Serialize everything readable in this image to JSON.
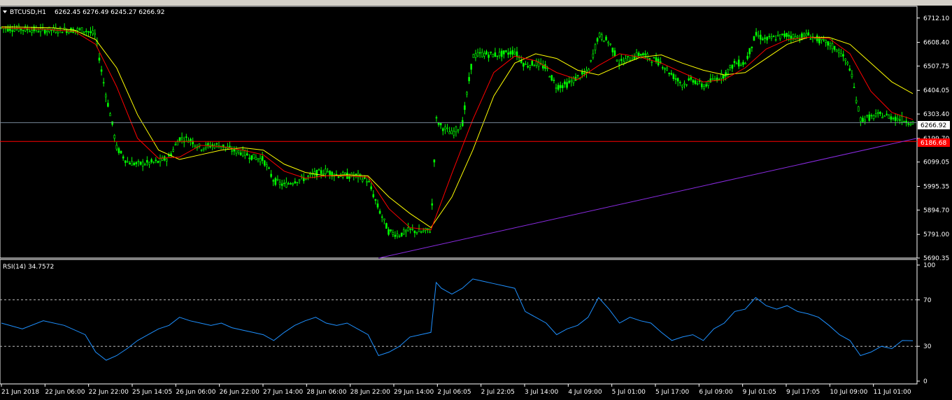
{
  "toolbar": {},
  "price_panel": {
    "title": "BTCUSD,H1",
    "ohlc": "6262.45 6276.49 6245.27 6266.92",
    "current_price_label": "6266.92",
    "red_line_label": "6186.68"
  },
  "rsi_panel": {
    "title": "RSI(14) 34.7572"
  },
  "colors": {
    "background": "#000000",
    "candle": "#00ff00",
    "ma_fast": "#ff0000",
    "ma_slow": "#ffff00",
    "trendline": "#8a2be2",
    "rsi_line": "#1e90ff",
    "horizontal_level": "#ff0000",
    "current_price_line": "#778899",
    "grid_text": "#ffffff"
  },
  "chart_data": [
    {
      "type": "candlestick",
      "symbol": "BTCUSD",
      "timeframe": "H1",
      "ylim": [
        5690.35,
        6762
      ],
      "yticks": [
        6712.1,
        6608.4,
        6507.75,
        6404.05,
        6303.4,
        6199.7,
        6099.05,
        5995.35,
        5894.7,
        5791.0,
        5690.35
      ],
      "ytick_labels": [
        "6712.10",
        "6608.40",
        "6507.75",
        "6404.05",
        "6303.40",
        "6199.70",
        "6099.05",
        "5995.35",
        "5894.70",
        "5791.00",
        "5690.35"
      ],
      "xtick_labels": [
        "21 Jun 2018",
        "22 Jun 06:00",
        "22 Jun 22:00",
        "25 Jun 14:05",
        "26 Jun 06:00",
        "26 Jun 22:00",
        "27 Jun 14:00",
        "28 Jun 06:00",
        "28 Jun 22:00",
        "29 Jun 14:00",
        "2 Jul 06:05",
        "2 Jul 22:05",
        "3 Jul 14:00",
        "4 Jul 09:00",
        "5 Jul 01:00",
        "5 Jul 17:00",
        "6 Jul 09:00",
        "9 Jul 01:05",
        "9 Jul 17:05",
        "10 Jul 09:00",
        "11 Jul 01:00"
      ],
      "price_path": [
        [
          0,
          6670
        ],
        [
          4,
          6665
        ],
        [
          8,
          6660
        ],
        [
          12,
          6662
        ],
        [
          16,
          6660
        ],
        [
          18,
          6640
        ],
        [
          19,
          6500
        ],
        [
          20,
          6380
        ],
        [
          21,
          6280
        ],
        [
          22,
          6160
        ],
        [
          24,
          6100
        ],
        [
          26,
          6090
        ],
        [
          28,
          6095
        ],
        [
          30,
          6100
        ],
        [
          32,
          6120
        ],
        [
          34,
          6200
        ],
        [
          36,
          6195
        ],
        [
          38,
          6160
        ],
        [
          40,
          6170
        ],
        [
          42,
          6170
        ],
        [
          44,
          6150
        ],
        [
          46,
          6140
        ],
        [
          48,
          6120
        ],
        [
          50,
          6110
        ],
        [
          52,
          6020
        ],
        [
          54,
          6000
        ],
        [
          56,
          6020
        ],
        [
          58,
          6030
        ],
        [
          60,
          6050
        ],
        [
          62,
          6060
        ],
        [
          64,
          6045
        ],
        [
          66,
          6040
        ],
        [
          68,
          6040
        ],
        [
          70,
          6020
        ],
        [
          72,
          5900
        ],
        [
          74,
          5800
        ],
        [
          76,
          5790
        ],
        [
          78,
          5810
        ],
        [
          80,
          5800
        ],
        [
          82,
          5810
        ],
        [
          83,
          6280
        ],
        [
          84,
          6250
        ],
        [
          86,
          6220
        ],
        [
          88,
          6260
        ],
        [
          90,
          6550
        ],
        [
          92,
          6560
        ],
        [
          94,
          6555
        ],
        [
          96,
          6560
        ],
        [
          98,
          6570
        ],
        [
          100,
          6510
        ],
        [
          102,
          6520
        ],
        [
          104,
          6500
        ],
        [
          106,
          6420
        ],
        [
          108,
          6430
        ],
        [
          110,
          6460
        ],
        [
          112,
          6480
        ],
        [
          114,
          6640
        ],
        [
          116,
          6610
        ],
        [
          118,
          6520
        ],
        [
          120,
          6540
        ],
        [
          122,
          6560
        ],
        [
          124,
          6540
        ],
        [
          126,
          6520
        ],
        [
          128,
          6470
        ],
        [
          130,
          6430
        ],
        [
          132,
          6450
        ],
        [
          134,
          6420
        ],
        [
          136,
          6450
        ],
        [
          138,
          6470
        ],
        [
          140,
          6520
        ],
        [
          142,
          6520
        ],
        [
          144,
          6640
        ],
        [
          146,
          6620
        ],
        [
          148,
          6630
        ],
        [
          150,
          6640
        ],
        [
          152,
          6630
        ],
        [
          154,
          6640
        ],
        [
          156,
          6620
        ],
        [
          158,
          6600
        ],
        [
          160,
          6570
        ],
        [
          162,
          6500
        ],
        [
          164,
          6280
        ],
        [
          166,
          6290
        ],
        [
          168,
          6300
        ],
        [
          170,
          6290
        ],
        [
          172,
          6280
        ],
        [
          174,
          6266.92
        ]
      ],
      "ma_fast_path": [
        [
          0,
          6670
        ],
        [
          8,
          6665
        ],
        [
          14,
          6655
        ],
        [
          18,
          6600
        ],
        [
          22,
          6420
        ],
        [
          26,
          6200
        ],
        [
          30,
          6115
        ],
        [
          34,
          6120
        ],
        [
          38,
          6170
        ],
        [
          42,
          6165
        ],
        [
          46,
          6150
        ],
        [
          50,
          6130
        ],
        [
          54,
          6060
        ],
        [
          58,
          6030
        ],
        [
          62,
          6040
        ],
        [
          66,
          6040
        ],
        [
          70,
          6035
        ],
        [
          74,
          5900
        ],
        [
          78,
          5820
        ],
        [
          82,
          5810
        ],
        [
          86,
          6050
        ],
        [
          90,
          6280
        ],
        [
          94,
          6480
        ],
        [
          98,
          6550
        ],
        [
          102,
          6530
        ],
        [
          106,
          6480
        ],
        [
          110,
          6450
        ],
        [
          114,
          6510
        ],
        [
          118,
          6560
        ],
        [
          122,
          6545
        ],
        [
          126,
          6520
        ],
        [
          130,
          6480
        ],
        [
          134,
          6440
        ],
        [
          138,
          6450
        ],
        [
          142,
          6500
        ],
        [
          146,
          6580
        ],
        [
          150,
          6620
        ],
        [
          154,
          6630
        ],
        [
          158,
          6625
        ],
        [
          162,
          6560
        ],
        [
          166,
          6400
        ],
        [
          170,
          6310
        ],
        [
          174,
          6280
        ]
      ],
      "ma_slow_path": [
        [
          0,
          6675
        ],
        [
          10,
          6670
        ],
        [
          14,
          6660
        ],
        [
          18,
          6620
        ],
        [
          22,
          6500
        ],
        [
          26,
          6300
        ],
        [
          30,
          6150
        ],
        [
          34,
          6110
        ],
        [
          38,
          6130
        ],
        [
          42,
          6150
        ],
        [
          46,
          6160
        ],
        [
          50,
          6150
        ],
        [
          54,
          6090
        ],
        [
          58,
          6055
        ],
        [
          62,
          6040
        ],
        [
          66,
          6045
        ],
        [
          70,
          6040
        ],
        [
          74,
          5950
        ],
        [
          78,
          5880
        ],
        [
          82,
          5820
        ],
        [
          86,
          5950
        ],
        [
          90,
          6150
        ],
        [
          94,
          6380
        ],
        [
          98,
          6520
        ],
        [
          102,
          6560
        ],
        [
          106,
          6540
        ],
        [
          110,
          6490
        ],
        [
          114,
          6470
        ],
        [
          118,
          6510
        ],
        [
          122,
          6545
        ],
        [
          126,
          6555
        ],
        [
          130,
          6520
        ],
        [
          134,
          6490
        ],
        [
          138,
          6470
        ],
        [
          142,
          6480
        ],
        [
          146,
          6540
        ],
        [
          150,
          6600
        ],
        [
          154,
          6630
        ],
        [
          158,
          6630
        ],
        [
          162,
          6600
        ],
        [
          166,
          6520
        ],
        [
          170,
          6440
        ],
        [
          174,
          6390
        ]
      ],
      "horizontal_level": 6186.68,
      "current_price": 6266.92,
      "trendline": [
        [
          72,
          5690
        ],
        [
          174,
          6200
        ]
      ]
    },
    {
      "type": "line",
      "indicator": "RSI(14)",
      "ylim": [
        0,
        100
      ],
      "yticks": [
        100,
        70,
        30,
        0
      ],
      "ytick_labels": [
        "100",
        "70",
        "30",
        "0"
      ],
      "reference_levels": [
        70,
        30
      ],
      "x_range": [
        0,
        174
      ],
      "values": [
        [
          0,
          50
        ],
        [
          4,
          45
        ],
        [
          8,
          52
        ],
        [
          12,
          48
        ],
        [
          16,
          40
        ],
        [
          18,
          25
        ],
        [
          20,
          18
        ],
        [
          22,
          22
        ],
        [
          24,
          28
        ],
        [
          26,
          35
        ],
        [
          28,
          40
        ],
        [
          30,
          45
        ],
        [
          32,
          48
        ],
        [
          34,
          55
        ],
        [
          36,
          52
        ],
        [
          38,
          50
        ],
        [
          40,
          48
        ],
        [
          42,
          50
        ],
        [
          44,
          46
        ],
        [
          46,
          44
        ],
        [
          48,
          42
        ],
        [
          50,
          40
        ],
        [
          52,
          35
        ],
        [
          54,
          42
        ],
        [
          56,
          48
        ],
        [
          58,
          52
        ],
        [
          60,
          55
        ],
        [
          62,
          50
        ],
        [
          64,
          48
        ],
        [
          66,
          50
        ],
        [
          68,
          45
        ],
        [
          70,
          40
        ],
        [
          72,
          22
        ],
        [
          74,
          25
        ],
        [
          76,
          30
        ],
        [
          78,
          38
        ],
        [
          80,
          40
        ],
        [
          82,
          42
        ],
        [
          83,
          85
        ],
        [
          84,
          80
        ],
        [
          86,
          75
        ],
        [
          88,
          80
        ],
        [
          90,
          88
        ],
        [
          92,
          86
        ],
        [
          94,
          84
        ],
        [
          96,
          82
        ],
        [
          98,
          80
        ],
        [
          100,
          60
        ],
        [
          102,
          55
        ],
        [
          104,
          50
        ],
        [
          106,
          40
        ],
        [
          108,
          45
        ],
        [
          110,
          48
        ],
        [
          112,
          55
        ],
        [
          114,
          72
        ],
        [
          116,
          62
        ],
        [
          118,
          50
        ],
        [
          120,
          55
        ],
        [
          122,
          52
        ],
        [
          124,
          50
        ],
        [
          126,
          42
        ],
        [
          128,
          35
        ],
        [
          130,
          38
        ],
        [
          132,
          40
        ],
        [
          134,
          35
        ],
        [
          136,
          45
        ],
        [
          138,
          50
        ],
        [
          140,
          60
        ],
        [
          142,
          62
        ],
        [
          144,
          72
        ],
        [
          146,
          65
        ],
        [
          148,
          62
        ],
        [
          150,
          65
        ],
        [
          152,
          60
        ],
        [
          154,
          58
        ],
        [
          156,
          55
        ],
        [
          158,
          48
        ],
        [
          160,
          40
        ],
        [
          162,
          35
        ],
        [
          164,
          22
        ],
        [
          166,
          25
        ],
        [
          168,
          30
        ],
        [
          170,
          28
        ],
        [
          172,
          35
        ],
        [
          174,
          34.7572
        ]
      ]
    }
  ]
}
